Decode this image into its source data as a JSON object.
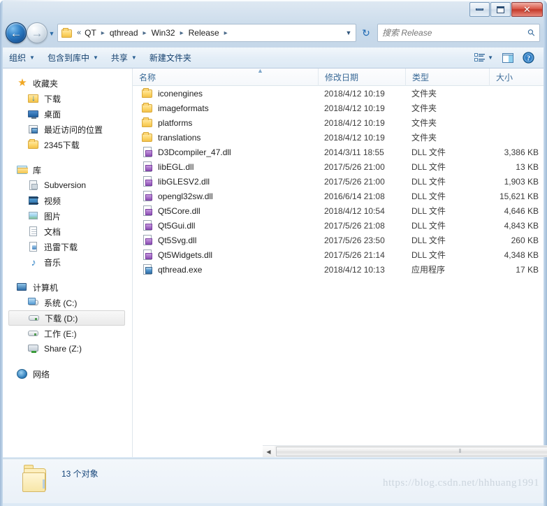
{
  "window": {
    "caption_buttons": [
      {
        "name": "minimize",
        "label": ""
      },
      {
        "name": "maximize",
        "label": ""
      },
      {
        "name": "close",
        "label": "✕"
      }
    ]
  },
  "navigation": {
    "back_glyph": "←",
    "forward_glyph": "→",
    "recent_glyph": "▼",
    "address_lead": "«",
    "breadcrumbs": [
      "QT",
      "qthread",
      "Win32",
      "Release"
    ],
    "crumb_separator": "▸",
    "dropdown_glyph": "▼",
    "refresh_glyph": "↻",
    "search": {
      "placeholder": "搜索 Release",
      "value": "",
      "icon": "⚲"
    }
  },
  "toolbar": {
    "items": [
      {
        "label": "组织",
        "has_caret": true
      },
      {
        "label": "包含到库中",
        "has_caret": true
      },
      {
        "label": "共享",
        "has_caret": true
      },
      {
        "label": "新建文件夹",
        "has_caret": false
      }
    ],
    "caret": "▼",
    "view_caret": "▼",
    "help_glyph": "?"
  },
  "sidebar": {
    "groups": [
      {
        "root": {
          "label": "收藏夹",
          "icon": "star-icon"
        },
        "children": [
          {
            "label": "下载",
            "icon": "download-folder-icon",
            "selected": false
          },
          {
            "label": "桌面",
            "icon": "desktop-icon",
            "selected": false
          },
          {
            "label": "最近访问的位置",
            "icon": "recent-places-icon",
            "selected": false
          },
          {
            "label": "2345下载",
            "icon": "folder-icon",
            "selected": false
          }
        ]
      },
      {
        "root": {
          "label": "库",
          "icon": "library-icon"
        },
        "children": [
          {
            "label": "Subversion",
            "icon": "subversion-icon",
            "selected": false
          },
          {
            "label": "视频",
            "icon": "video-icon",
            "selected": false
          },
          {
            "label": "图片",
            "icon": "pictures-icon",
            "selected": false
          },
          {
            "label": "文档",
            "icon": "documents-icon",
            "selected": false
          },
          {
            "label": "迅雷下载",
            "icon": "xunlei-icon",
            "selected": false
          },
          {
            "label": "音乐",
            "icon": "music-icon",
            "selected": false
          }
        ]
      },
      {
        "root": {
          "label": "计算机",
          "icon": "computer-icon"
        },
        "children": [
          {
            "label": "系统 (C:)",
            "icon": "system-drive-icon",
            "selected": false
          },
          {
            "label": "下载 (D:)",
            "icon": "drive-icon",
            "selected": true
          },
          {
            "label": "工作 (E:)",
            "icon": "drive-icon",
            "selected": false
          },
          {
            "label": "Share (Z:)",
            "icon": "network-drive-icon",
            "selected": false
          }
        ]
      },
      {
        "root": {
          "label": "网络",
          "icon": "network-icon"
        },
        "children": []
      }
    ]
  },
  "filelist": {
    "columns": [
      {
        "key": "name",
        "label": "名称"
      },
      {
        "key": "date",
        "label": "修改日期"
      },
      {
        "key": "type",
        "label": "类型"
      },
      {
        "key": "size",
        "label": "大小"
      }
    ],
    "sort_indicator": "▲",
    "rows": [
      {
        "name": "iconengines",
        "date": "2018/4/12 10:19",
        "type": "文件夹",
        "size": "",
        "icon": "folder-icon"
      },
      {
        "name": "imageformats",
        "date": "2018/4/12 10:19",
        "type": "文件夹",
        "size": "",
        "icon": "folder-icon"
      },
      {
        "name": "platforms",
        "date": "2018/4/12 10:19",
        "type": "文件夹",
        "size": "",
        "icon": "folder-icon"
      },
      {
        "name": "translations",
        "date": "2018/4/12 10:19",
        "type": "文件夹",
        "size": "",
        "icon": "folder-icon"
      },
      {
        "name": "D3Dcompiler_47.dll",
        "date": "2014/3/11 18:55",
        "type": "DLL 文件",
        "size": "3,386 KB",
        "icon": "dll-file-icon"
      },
      {
        "name": "libEGL.dll",
        "date": "2017/5/26 21:00",
        "type": "DLL 文件",
        "size": "13 KB",
        "icon": "dll-file-icon"
      },
      {
        "name": "libGLESV2.dll",
        "date": "2017/5/26 21:00",
        "type": "DLL 文件",
        "size": "1,903 KB",
        "icon": "dll-file-icon"
      },
      {
        "name": "opengl32sw.dll",
        "date": "2016/6/14 21:08",
        "type": "DLL 文件",
        "size": "15,621 KB",
        "icon": "dll-file-icon"
      },
      {
        "name": "Qt5Core.dll",
        "date": "2018/4/12 10:54",
        "type": "DLL 文件",
        "size": "4,646 KB",
        "icon": "dll-file-icon"
      },
      {
        "name": "Qt5Gui.dll",
        "date": "2017/5/26 21:08",
        "type": "DLL 文件",
        "size": "4,843 KB",
        "icon": "dll-file-icon"
      },
      {
        "name": "Qt5Svg.dll",
        "date": "2017/5/26 23:50",
        "type": "DLL 文件",
        "size": "260 KB",
        "icon": "dll-file-icon"
      },
      {
        "name": "Qt5Widgets.dll",
        "date": "2017/5/26 21:14",
        "type": "DLL 文件",
        "size": "4,348 KB",
        "icon": "dll-file-icon"
      },
      {
        "name": "qthread.exe",
        "date": "2018/4/12 10:13",
        "type": "应用程序",
        "size": "17 KB",
        "icon": "exe-file-icon"
      }
    ]
  },
  "scrollbar": {
    "left_arrow": "◀",
    "right_arrow": "▶",
    "grip": "⫴"
  },
  "statusbar": {
    "text": "13 个对象"
  },
  "watermark": {
    "text": "https://blog.csdn.net/hhhuang1991"
  },
  "colors": {
    "accent": "#1d68b3",
    "glass": "#cfdfee",
    "close_red": "#c33a2a",
    "header_text": "#3a6a97"
  }
}
